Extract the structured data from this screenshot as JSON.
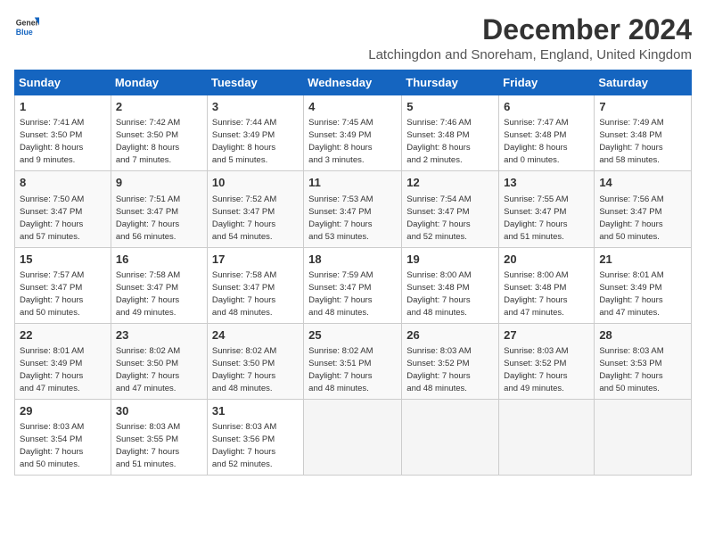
{
  "header": {
    "logo_general": "General",
    "logo_blue": "Blue",
    "title": "December 2024",
    "subtitle": "Latchingdon and Snoreham, England, United Kingdom"
  },
  "columns": [
    "Sunday",
    "Monday",
    "Tuesday",
    "Wednesday",
    "Thursday",
    "Friday",
    "Saturday"
  ],
  "weeks": [
    [
      {
        "day": "1",
        "info": "Sunrise: 7:41 AM\nSunset: 3:50 PM\nDaylight: 8 hours\nand 9 minutes."
      },
      {
        "day": "2",
        "info": "Sunrise: 7:42 AM\nSunset: 3:50 PM\nDaylight: 8 hours\nand 7 minutes."
      },
      {
        "day": "3",
        "info": "Sunrise: 7:44 AM\nSunset: 3:49 PM\nDaylight: 8 hours\nand 5 minutes."
      },
      {
        "day": "4",
        "info": "Sunrise: 7:45 AM\nSunset: 3:49 PM\nDaylight: 8 hours\nand 3 minutes."
      },
      {
        "day": "5",
        "info": "Sunrise: 7:46 AM\nSunset: 3:48 PM\nDaylight: 8 hours\nand 2 minutes."
      },
      {
        "day": "6",
        "info": "Sunrise: 7:47 AM\nSunset: 3:48 PM\nDaylight: 8 hours\nand 0 minutes."
      },
      {
        "day": "7",
        "info": "Sunrise: 7:49 AM\nSunset: 3:48 PM\nDaylight: 7 hours\nand 58 minutes."
      }
    ],
    [
      {
        "day": "8",
        "info": "Sunrise: 7:50 AM\nSunset: 3:47 PM\nDaylight: 7 hours\nand 57 minutes."
      },
      {
        "day": "9",
        "info": "Sunrise: 7:51 AM\nSunset: 3:47 PM\nDaylight: 7 hours\nand 56 minutes."
      },
      {
        "day": "10",
        "info": "Sunrise: 7:52 AM\nSunset: 3:47 PM\nDaylight: 7 hours\nand 54 minutes."
      },
      {
        "day": "11",
        "info": "Sunrise: 7:53 AM\nSunset: 3:47 PM\nDaylight: 7 hours\nand 53 minutes."
      },
      {
        "day": "12",
        "info": "Sunrise: 7:54 AM\nSunset: 3:47 PM\nDaylight: 7 hours\nand 52 minutes."
      },
      {
        "day": "13",
        "info": "Sunrise: 7:55 AM\nSunset: 3:47 PM\nDaylight: 7 hours\nand 51 minutes."
      },
      {
        "day": "14",
        "info": "Sunrise: 7:56 AM\nSunset: 3:47 PM\nDaylight: 7 hours\nand 50 minutes."
      }
    ],
    [
      {
        "day": "15",
        "info": "Sunrise: 7:57 AM\nSunset: 3:47 PM\nDaylight: 7 hours\nand 50 minutes."
      },
      {
        "day": "16",
        "info": "Sunrise: 7:58 AM\nSunset: 3:47 PM\nDaylight: 7 hours\nand 49 minutes."
      },
      {
        "day": "17",
        "info": "Sunrise: 7:58 AM\nSunset: 3:47 PM\nDaylight: 7 hours\nand 48 minutes."
      },
      {
        "day": "18",
        "info": "Sunrise: 7:59 AM\nSunset: 3:47 PM\nDaylight: 7 hours\nand 48 minutes."
      },
      {
        "day": "19",
        "info": "Sunrise: 8:00 AM\nSunset: 3:48 PM\nDaylight: 7 hours\nand 48 minutes."
      },
      {
        "day": "20",
        "info": "Sunrise: 8:00 AM\nSunset: 3:48 PM\nDaylight: 7 hours\nand 47 minutes."
      },
      {
        "day": "21",
        "info": "Sunrise: 8:01 AM\nSunset: 3:49 PM\nDaylight: 7 hours\nand 47 minutes."
      }
    ],
    [
      {
        "day": "22",
        "info": "Sunrise: 8:01 AM\nSunset: 3:49 PM\nDaylight: 7 hours\nand 47 minutes."
      },
      {
        "day": "23",
        "info": "Sunrise: 8:02 AM\nSunset: 3:50 PM\nDaylight: 7 hours\nand 47 minutes."
      },
      {
        "day": "24",
        "info": "Sunrise: 8:02 AM\nSunset: 3:50 PM\nDaylight: 7 hours\nand 48 minutes."
      },
      {
        "day": "25",
        "info": "Sunrise: 8:02 AM\nSunset: 3:51 PM\nDaylight: 7 hours\nand 48 minutes."
      },
      {
        "day": "26",
        "info": "Sunrise: 8:03 AM\nSunset: 3:52 PM\nDaylight: 7 hours\nand 48 minutes."
      },
      {
        "day": "27",
        "info": "Sunrise: 8:03 AM\nSunset: 3:52 PM\nDaylight: 7 hours\nand 49 minutes."
      },
      {
        "day": "28",
        "info": "Sunrise: 8:03 AM\nSunset: 3:53 PM\nDaylight: 7 hours\nand 50 minutes."
      }
    ],
    [
      {
        "day": "29",
        "info": "Sunrise: 8:03 AM\nSunset: 3:54 PM\nDaylight: 7 hours\nand 50 minutes."
      },
      {
        "day": "30",
        "info": "Sunrise: 8:03 AM\nSunset: 3:55 PM\nDaylight: 7 hours\nand 51 minutes."
      },
      {
        "day": "31",
        "info": "Sunrise: 8:03 AM\nSunset: 3:56 PM\nDaylight: 7 hours\nand 52 minutes."
      },
      null,
      null,
      null,
      null
    ]
  ]
}
